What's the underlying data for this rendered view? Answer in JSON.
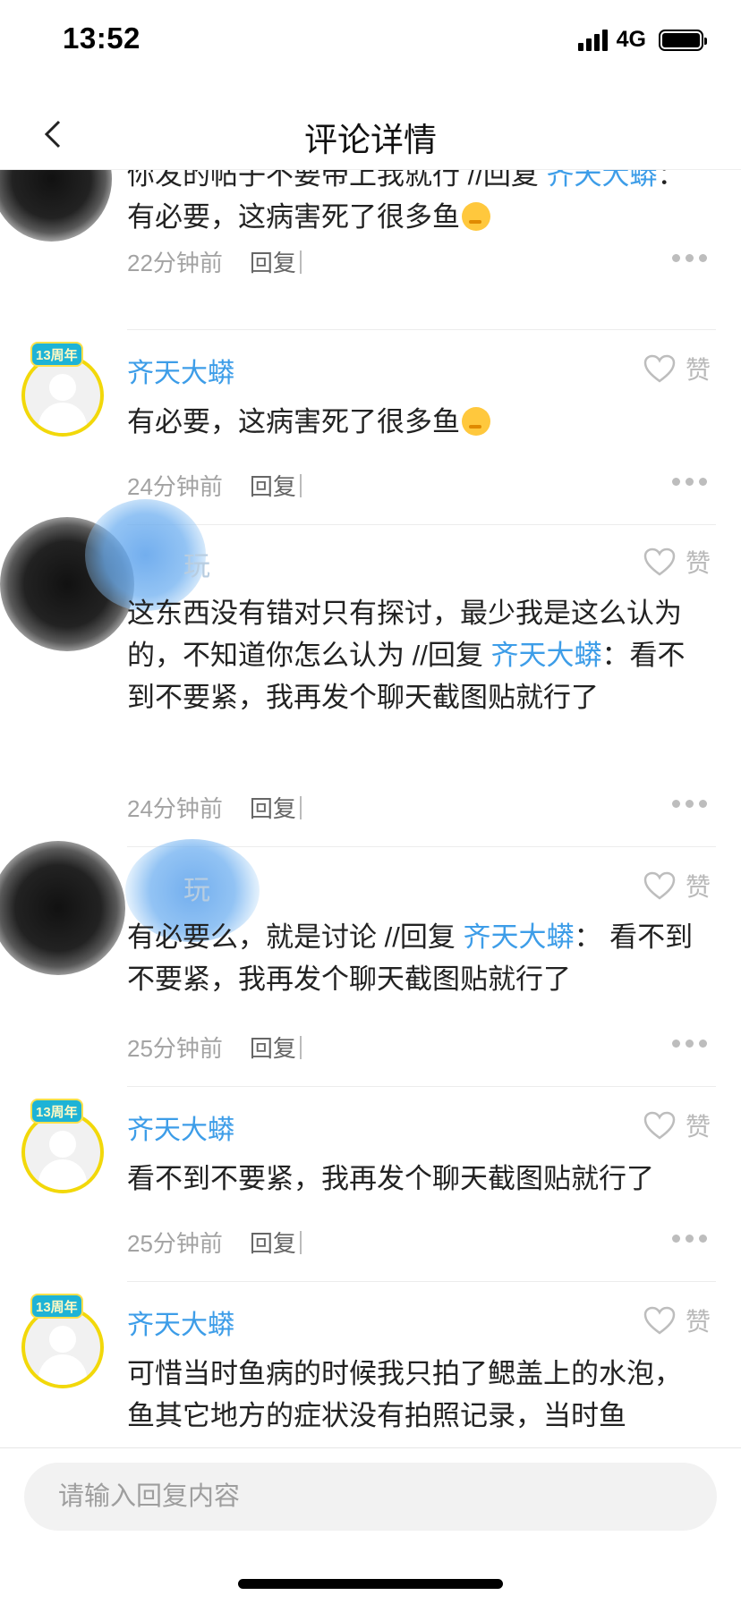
{
  "status_bar": {
    "time": "13:52",
    "network": "4G",
    "signal_icon": "signal-bars-icon",
    "battery_icon": "battery-full-icon"
  },
  "nav": {
    "title": "评论详情",
    "back_icon": "chevron-left-icon"
  },
  "comments": [
    {
      "username": "",
      "text": "你发的帖子不要带上我就行 //回复 ",
      "mention": "齐天大蟒",
      "text_after": "： 有必要，这病害死了很多鱼",
      "emoji": "thinking-face-emoji",
      "time": "22分钟前",
      "reply_label": "回复"
    },
    {
      "username": "齐天大蟒",
      "badge": "13周年",
      "text": "有必要，这病害死了很多鱼",
      "emoji": "thinking-face-emoji",
      "like_label": "赞",
      "time": "24分钟前",
      "reply_label": "回复"
    },
    {
      "username": "玩",
      "text": "这东西没有错对只有探讨，最少我是这么认为的，不知道你怎么认为 //回复 ",
      "mention": "齐天大蟒",
      "text_after": "：看不到不要紧，我再发个聊天截图贴就行了",
      "like_label": "赞",
      "time": "24分钟前",
      "reply_label": "回复"
    },
    {
      "username": "玩",
      "text": "有必要么，就是讨论 //回复 ",
      "mention": "齐天大蟒",
      "text_after": "： 看不到不要紧，我再发个聊天截图贴就行了",
      "like_label": "赞",
      "time": "25分钟前",
      "reply_label": "回复"
    },
    {
      "username": "齐天大蟒",
      "badge": "13周年",
      "text": "看不到不要紧，我再发个聊天截图贴就行了",
      "like_label": "赞",
      "time": "25分钟前",
      "reply_label": "回复"
    },
    {
      "username": "齐天大蟒",
      "badge": "13周年",
      "text": "可惜当时鱼病的时候我只拍了鳃盖上的水泡，鱼其它地方的症状没有拍照记录，当时鱼",
      "like_label": "赞"
    }
  ],
  "reply_input": {
    "placeholder": "请输入回复内容"
  },
  "colors": {
    "accent": "#3d9de8",
    "avatar_ring": "#f2d80a",
    "muted": "#a3a3a3"
  }
}
